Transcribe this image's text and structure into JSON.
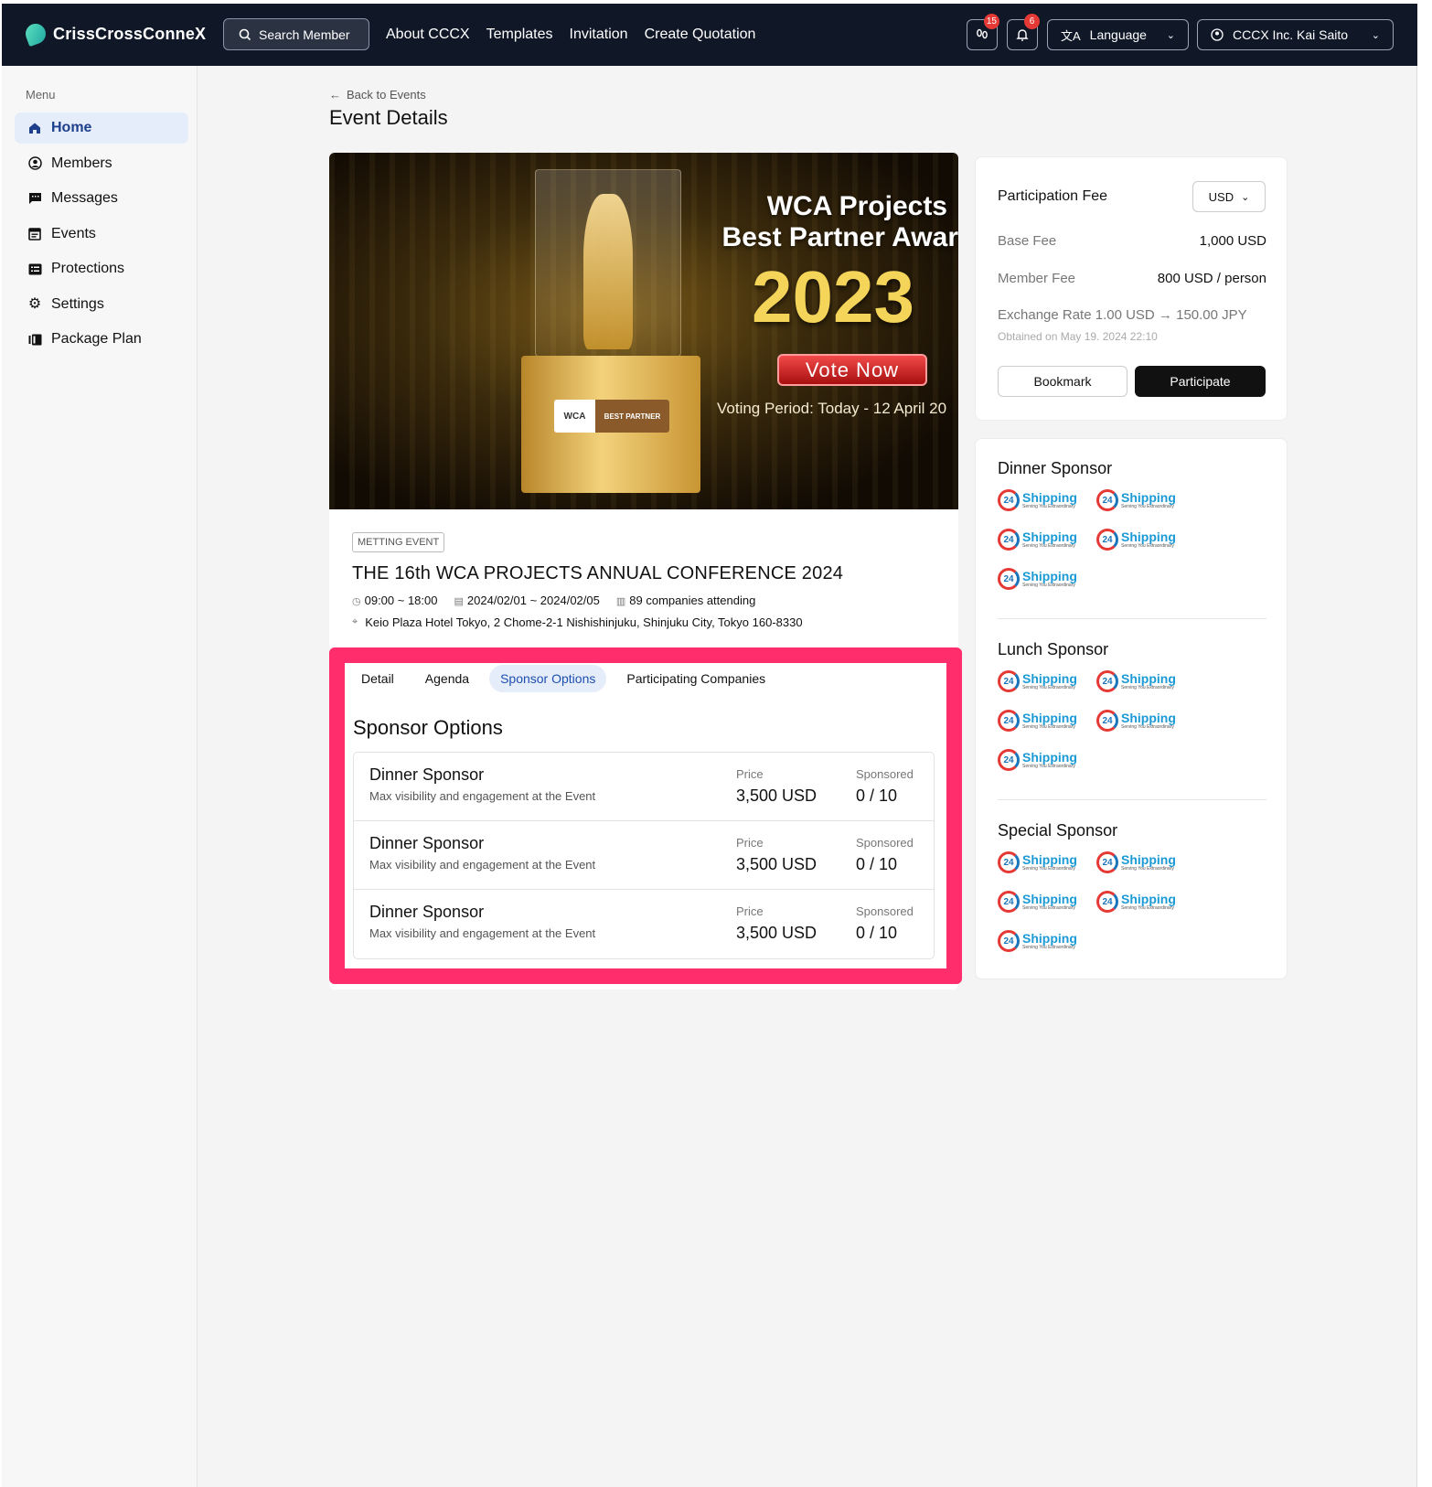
{
  "app": {
    "name": "CrissCrossConneX",
    "search_label": "Search Member",
    "nav": [
      "About CCCX",
      "Templates",
      "Invitation",
      "Create Quotation"
    ],
    "badges": {
      "messages": "15",
      "notifications": "6"
    },
    "language_label": "Language",
    "account_label": "CCCX Inc. Kai Saito"
  },
  "sidebar": {
    "menu_label": "Menu",
    "items": [
      {
        "label": "Home",
        "icon": "home-icon",
        "active": true
      },
      {
        "label": "Members",
        "icon": "user-circle-icon"
      },
      {
        "label": "Messages",
        "icon": "message-icon"
      },
      {
        "label": "Events",
        "icon": "calendar-icon"
      },
      {
        "label": "Protections",
        "icon": "shield-list-icon"
      },
      {
        "label": "Settings",
        "icon": "gear-icon"
      },
      {
        "label": "Package Plan",
        "icon": "package-icon"
      }
    ]
  },
  "main": {
    "back_label": "Back to Events",
    "title": "Event Details"
  },
  "banner": {
    "title_line1": "WCA Projects",
    "title_line2": "Best Partner Awar",
    "year": "2023",
    "vote": "Vote Now",
    "period": "Voting Period: Today - 12 April 20",
    "plaque_logo": "WCA",
    "plaque_text": "BEST PARTNER"
  },
  "event": {
    "type": "METTING EVENT",
    "name": "THE 16th WCA PROJECTS ANNUAL CONFERENCE 2024",
    "time": "09:00 ~ 18:00",
    "dates": "2024/02/01 ~ 2024/02/05",
    "attending": "89 companies attending",
    "location": "Keio Plaza Hotel Tokyo, 2 Chome-2-1 Nishishinjuku, Shinjuku City, Tokyo 160-8330"
  },
  "tabs": [
    "Detail",
    "Agenda",
    "Sponsor Options",
    "Participating Companies"
  ],
  "active_tab": "Sponsor Options",
  "sponsor_options": {
    "title": "Sponsor Options",
    "price_label": "Price",
    "sponsored_label": "Sponsored",
    "rows": [
      {
        "name": "Dinner Sponsor",
        "desc": "Max visibility and engagement at the Event",
        "price": "3,500 USD",
        "sponsored": "0 / 10"
      },
      {
        "name": "Dinner Sponsor",
        "desc": "Max visibility and engagement at the Event",
        "price": "3,500 USD",
        "sponsored": "0 / 10"
      },
      {
        "name": "Dinner Sponsor",
        "desc": "Max visibility and engagement at the Event",
        "price": "3,500 USD",
        "sponsored": "0 / 10"
      }
    ]
  },
  "fee": {
    "title": "Participation Fee",
    "currency": "USD",
    "base_label": "Base Fee",
    "base_value": "1,000 USD",
    "member_label": "Member Fee",
    "member_value": "800 USD / person",
    "exchange": "Exchange Rate 1.00 USD → 150.00 JPY",
    "obtained": "Obtained on May 19. 2024 22:10",
    "bookmark": "Bookmark",
    "participate": "Participate"
  },
  "sponsors": {
    "logo_text": "Shipping",
    "logo_tagline": "Serving You Extraordinary",
    "logo_mark": "24",
    "sections": [
      {
        "title": "Dinner Sponsor",
        "count": 5
      },
      {
        "title": "Lunch Sponsor",
        "count": 5
      },
      {
        "title": "Special Sponsor",
        "count": 5
      }
    ]
  },
  "colors": {
    "topbar": "#101828",
    "highlight_frame": "#ff2d6b",
    "active_tab_bg": "#e6edfa",
    "active_tab_text": "#1d4fb0",
    "badge": "#e53935"
  }
}
